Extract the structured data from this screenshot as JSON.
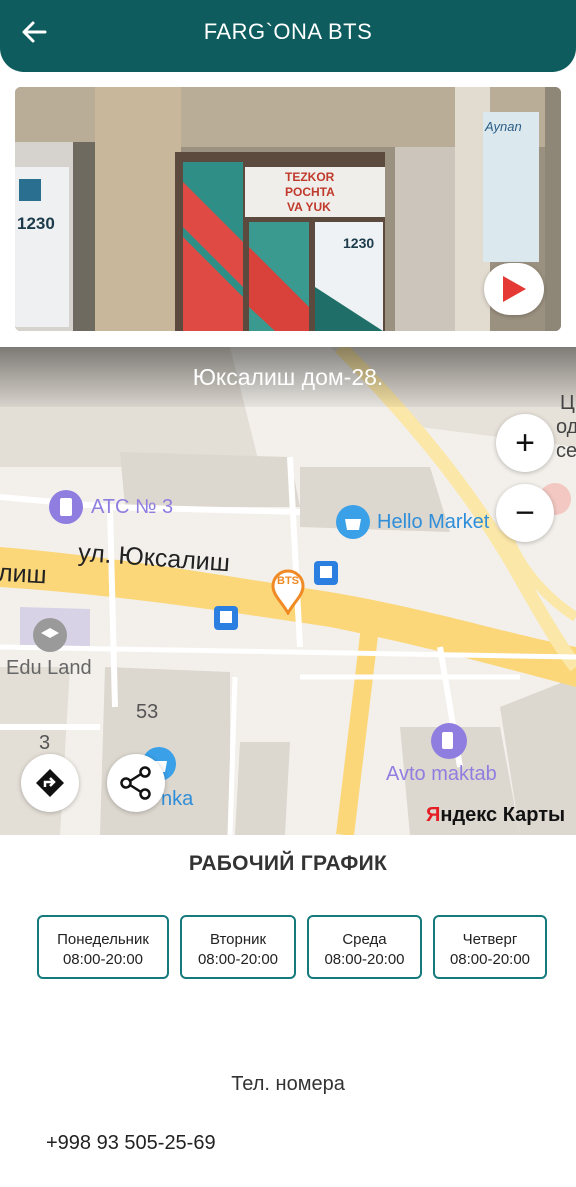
{
  "header": {
    "title": "FARG`ONA BTS",
    "back_icon": "arrow-left-icon"
  },
  "photo": {
    "sign_line1": "TEZKOR",
    "sign_line2": "POCHTA",
    "sign_line3": "VA YUK",
    "phone_on_door": "1230",
    "phone_on_left": "1230",
    "poster_text": "Aynan",
    "play_icon": "play-icon"
  },
  "map": {
    "address": "Юксалиш дом-28.",
    "poi_ats": "АТС № 3",
    "poi_hello": "Hello Market",
    "street_name": "ул. Юксалиш",
    "street_left": "лиш",
    "poi_edu": "Edu Land",
    "number_53": "53",
    "number_3": "3",
    "poi_avto": "Avto maktab",
    "poi_nka": "nka",
    "marker_label": "BTS",
    "edge_right_1": "Ц",
    "edge_right_2": "одп",
    "edge_right_3": "се",
    "zoom_in": "+",
    "zoom_out": "−",
    "provider_logo_y": "Я",
    "provider_logo_rest": "ндекс Карты"
  },
  "schedule": {
    "title": "РАБОЧИЙ ГРАФИК",
    "days": [
      {
        "name": "Понедельник",
        "hours": "08:00-20:00"
      },
      {
        "name": "Вторник",
        "hours": "08:00-20:00"
      },
      {
        "name": "Среда",
        "hours": "08:00-20:00"
      },
      {
        "name": "Четверг",
        "hours": "08:00-20:00"
      }
    ]
  },
  "contacts": {
    "title": "Тел. номера",
    "phone": "+998 93 505-25-69"
  },
  "colors": {
    "primary": "#0e5c5d",
    "accent": "#167a7c",
    "marker": "#f08a24",
    "play": "#e53935"
  }
}
